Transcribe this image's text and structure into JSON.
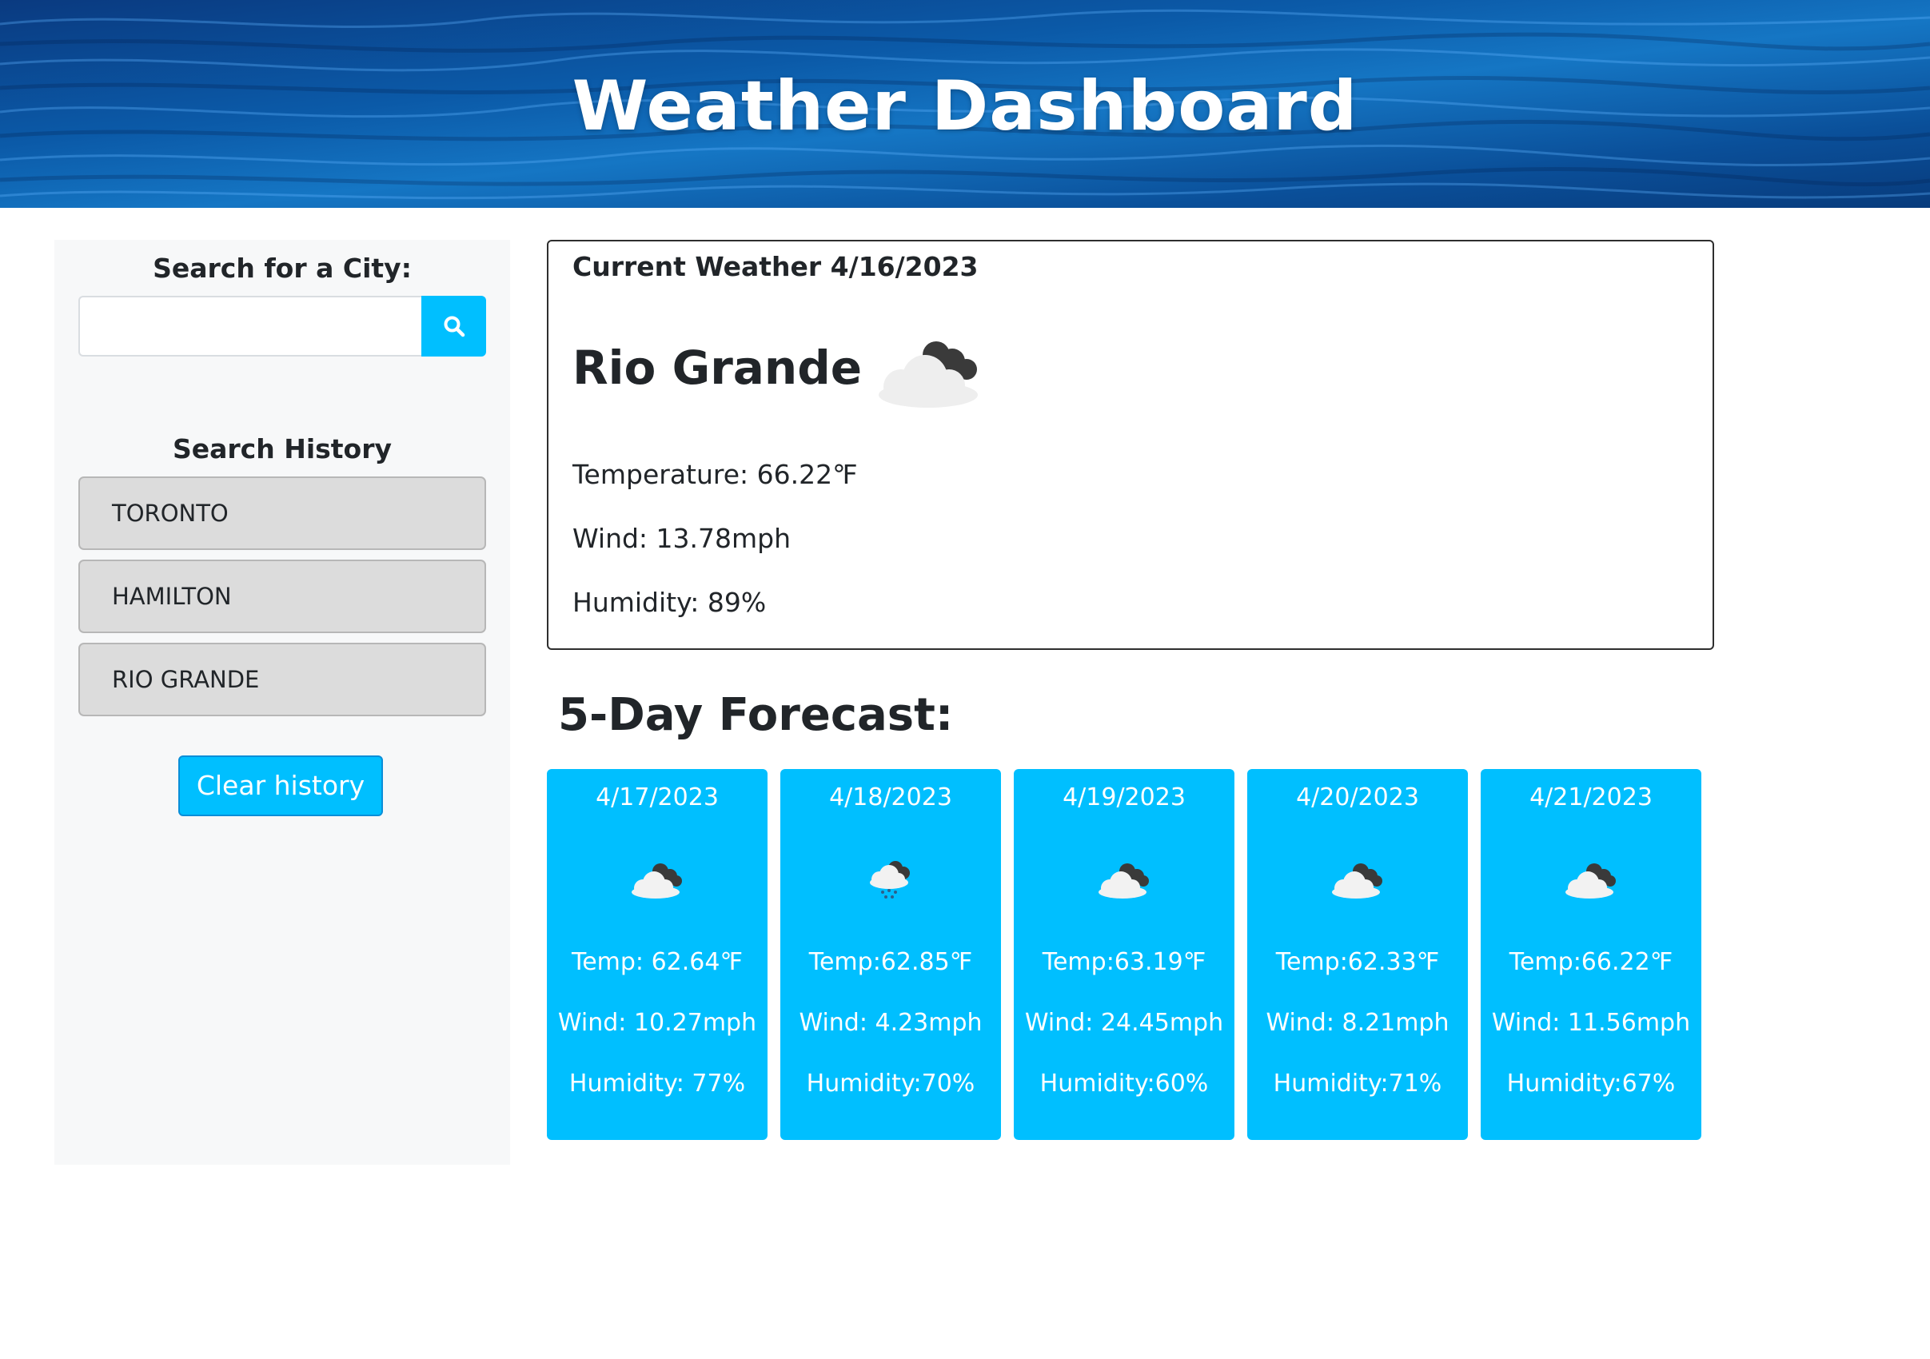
{
  "header": {
    "title": "Weather Dashboard"
  },
  "sidebar": {
    "search_label": "Search for a City:",
    "search_value": "",
    "search_icon": "search-icon",
    "history_title": "Search History",
    "history": [
      {
        "label": "TORONTO"
      },
      {
        "label": "HAMILTON"
      },
      {
        "label": "RIO GRANDE"
      }
    ],
    "clear_label": "Clear history"
  },
  "current": {
    "header": "Current Weather 4/16/2023",
    "city": "Rio Grande",
    "icon": "partly-cloudy-icon",
    "temperature": "Temperature: 66.22℉",
    "wind": "Wind: 13.78mph",
    "humidity": "Humidity: 89%"
  },
  "forecast": {
    "title": "5-Day Forecast:",
    "days": [
      {
        "date": "4/17/2023",
        "icon": "partly-cloudy-icon",
        "temp": "Temp: 62.64℉",
        "wind": "Wind: 10.27mph",
        "humidity": "Humidity: 77%"
      },
      {
        "date": "4/18/2023",
        "icon": "rain-cloud-icon",
        "temp": "Temp:62.85℉",
        "wind": "Wind: 4.23mph",
        "humidity": "Humidity:70%"
      },
      {
        "date": "4/19/2023",
        "icon": "partly-cloudy-icon",
        "temp": "Temp:63.19℉",
        "wind": "Wind: 24.45mph",
        "humidity": "Humidity:60%"
      },
      {
        "date": "4/20/2023",
        "icon": "partly-cloudy-icon",
        "temp": "Temp:62.33℉",
        "wind": "Wind: 8.21mph",
        "humidity": "Humidity:71%"
      },
      {
        "date": "4/21/2023",
        "icon": "partly-cloudy-icon",
        "temp": "Temp:66.22℉",
        "wind": "Wind: 11.56mph",
        "humidity": "Humidity:67%"
      }
    ]
  },
  "colors": {
    "accent": "#00bfff",
    "history_button_bg": "#dcdcdc",
    "sidebar_bg": "#f7f8f9",
    "header_water": "#0b55a0"
  }
}
